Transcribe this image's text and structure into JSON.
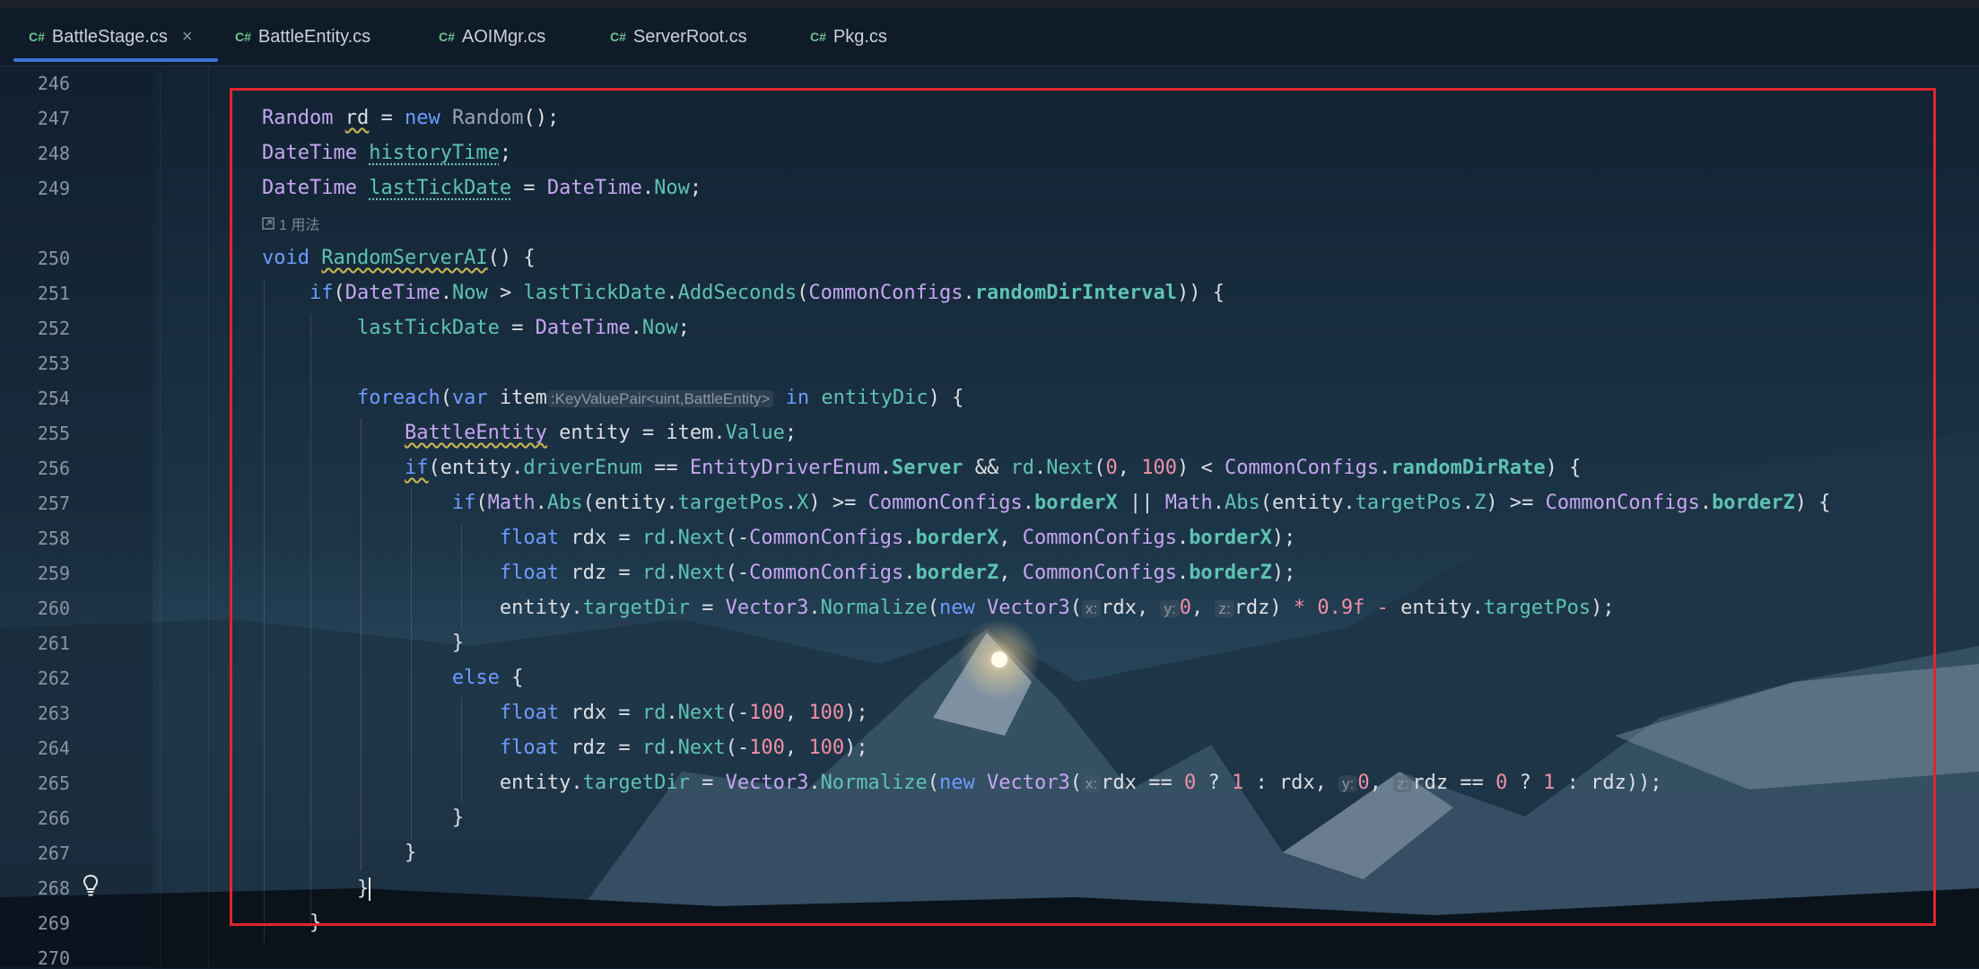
{
  "tabs": [
    {
      "lang": "C#",
      "label": "BattleStage.cs",
      "active": true,
      "close": "×"
    },
    {
      "lang": "C#",
      "label": "BattleEntity.cs"
    },
    {
      "lang": "C#",
      "label": "AOIMgr.cs"
    },
    {
      "lang": "C#",
      "label": "ServerRoot.cs"
    },
    {
      "lang": "C#",
      "label": "Pkg.cs"
    }
  ],
  "line_numbers": [
    "246",
    "247",
    "248",
    "249",
    "250",
    "251",
    "252",
    "253",
    "254",
    "255",
    "256",
    "257",
    "258",
    "259",
    "260",
    "261",
    "262",
    "263",
    "264",
    "265",
    "266",
    "267",
    "268",
    "269",
    "270"
  ],
  "usage_hint": "1 用法",
  "hints": {
    "foreach_type": ":KeyValuePair<uint,BattleEntity>",
    "x": "x:",
    "y": "y:",
    "z": "z:"
  },
  "code_lines": [
    "",
    "Random rd = new Random();",
    "DateTime historyTime;",
    "DateTime lastTickDate = DateTime.Now;",
    "void RandomServerAI() {",
    "    if(DateTime.Now > lastTickDate.AddSeconds(CommonConfigs.randomDirInterval)) {",
    "        lastTickDate = DateTime.Now;",
    "",
    "        foreach(var item in entityDic) {",
    "            BattleEntity entity = item.Value;",
    "            if(entity.driverEnum == EntityDriverEnum.Server && rd.Next(0, 100) < CommonConfigs.randomDirRate) {",
    "                if(Math.Abs(entity.targetPos.X) >= CommonConfigs.borderX || Math.Abs(entity.targetPos.Z) >= CommonConfigs.borderZ) {",
    "                    float rdx = rd.Next(-CommonConfigs.borderX, CommonConfigs.borderX);",
    "                    float rdz = rd.Next(-CommonConfigs.borderZ, CommonConfigs.borderZ);",
    "                    entity.targetDir = Vector3.Normalize(new Vector3(rdx, 0, rdz) * 0.9f - entity.targetPos);",
    "                }",
    "                else {",
    "                    float rdx = rd.Next(-100, 100);",
    "                    float rdz = rd.Next(-100, 100);",
    "                    entity.targetDir = Vector3.Normalize(new Vector3(rdx == 0 ? 1 : rdx, 0, rdz == 0 ? 1 : rdz));",
    "                }",
    "            }",
    "        }",
    "    }",
    ""
  ],
  "colors": {
    "accent": "#3d73d8",
    "highlight_rect": "#e0262f",
    "type": "#c7a6f2",
    "keyword": "#6f9bff",
    "member": "#5fc3b2",
    "number": "#f08fa8"
  }
}
